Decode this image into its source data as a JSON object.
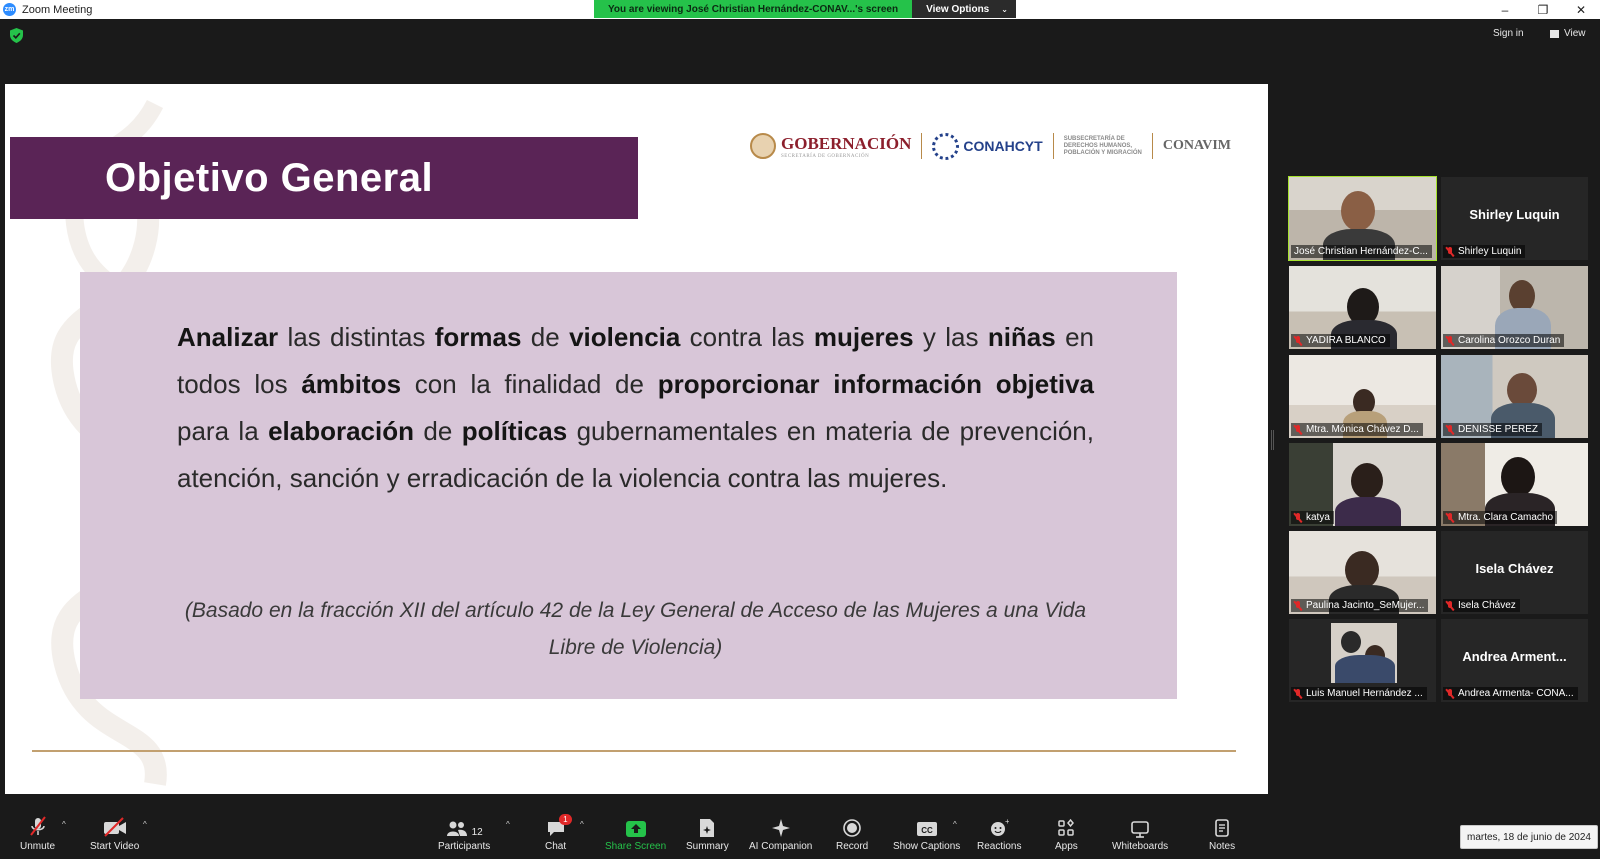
{
  "window": {
    "title": "Zoom Meeting",
    "controls": [
      "–",
      "❐",
      "✕"
    ]
  },
  "share_banner": {
    "viewing_text": "You are viewing José Christian Hernández-CONAV...'s screen",
    "view_options_label": "View Options"
  },
  "top_bar": {
    "sign_in_label": "Sign in",
    "view_label": "View"
  },
  "slide": {
    "title": "Objetivo General",
    "logos": {
      "gobernacion": "GOBERNACIÓN",
      "gobernacion_sub": "SECRETARÍA DE GOBERNACIÓN",
      "conahcyt": "CONAHCYT",
      "subsecretaria": [
        "SUBSECRETARÍA DE",
        "DERECHOS HUMANOS,",
        "POBLACIÓN Y MIGRACIÓN"
      ],
      "conavim": "CONAVIM"
    },
    "main_text": [
      {
        "text": "Analizar",
        "bold": true
      },
      {
        "text": " las distintas ",
        "bold": false
      },
      {
        "text": "formas",
        "bold": true
      },
      {
        "text": " de ",
        "bold": false
      },
      {
        "text": "violencia",
        "bold": true
      },
      {
        "text": " contra las ",
        "bold": false
      },
      {
        "text": "mujeres",
        "bold": true
      },
      {
        "text": " y las ",
        "bold": false
      },
      {
        "text": "niñas",
        "bold": true
      },
      {
        "text": " en todos los ",
        "bold": false
      },
      {
        "text": "ámbitos",
        "bold": true
      },
      {
        "text": " con la finalidad de ",
        "bold": false
      },
      {
        "text": "proporcionar información objetiva",
        "bold": true
      },
      {
        "text": " para la ",
        "bold": false
      },
      {
        "text": "elaboración",
        "bold": true
      },
      {
        "text": " de ",
        "bold": false
      },
      {
        "text": "políticas",
        "bold": true
      },
      {
        "text": " gubernamentales en materia de prevención, atención, sanción y erradicación de la violencia contra las mujeres.",
        "bold": false
      }
    ],
    "note": "(Basado en la fracción XII del artículo 42 de la Ley General de Acceso de las Mujeres a una Vida Libre de Violencia)"
  },
  "participants": [
    {
      "name": "José Christian Hernández-C...",
      "video": true,
      "active": true
    },
    {
      "name": "Shirley Luquin",
      "video": false,
      "display_name": "Shirley Luquin"
    },
    {
      "name": "YADIRA BLANCO",
      "video": true
    },
    {
      "name": "Carolina Orozco Duran",
      "video": true
    },
    {
      "name": "Mtra. Mónica Chávez D...",
      "video": true
    },
    {
      "name": "DENISSE PEREZ",
      "video": true
    },
    {
      "name": "katya",
      "video": true
    },
    {
      "name": "Mtra. Clara Camacho",
      "video": true
    },
    {
      "name": "Paulina Jacinto_SeMujer...",
      "video": true
    },
    {
      "name": "Isela Chávez",
      "video": false,
      "display_name": "Isela Chávez"
    },
    {
      "name": "Luis Manuel Hernández ...",
      "video": false,
      "has_photo": true
    },
    {
      "name": "Andrea Armenta- CONA...",
      "video": false,
      "display_name": "Andrea Arment..."
    }
  ],
  "toolbar": {
    "unmute": "Unmute",
    "start_video": "Start Video",
    "participants": "Participants",
    "participants_count": "12",
    "chat": "Chat",
    "chat_badge": "1",
    "share_screen": "Share Screen",
    "summary": "Summary",
    "ai_companion": "AI Companion",
    "record": "Record",
    "show_captions": "Show Captions",
    "reactions": "Reactions",
    "apps": "Apps",
    "whiteboards": "Whiteboards",
    "notes": "Notes"
  },
  "date_badge": "martes, 18 de junio de 2024",
  "colors": {
    "title_band": "#5a2456",
    "content_box": "#d8c6d8",
    "share_green": "#25c24a",
    "active_speaker": "#a6e22e",
    "muted_red": "#e02828"
  }
}
